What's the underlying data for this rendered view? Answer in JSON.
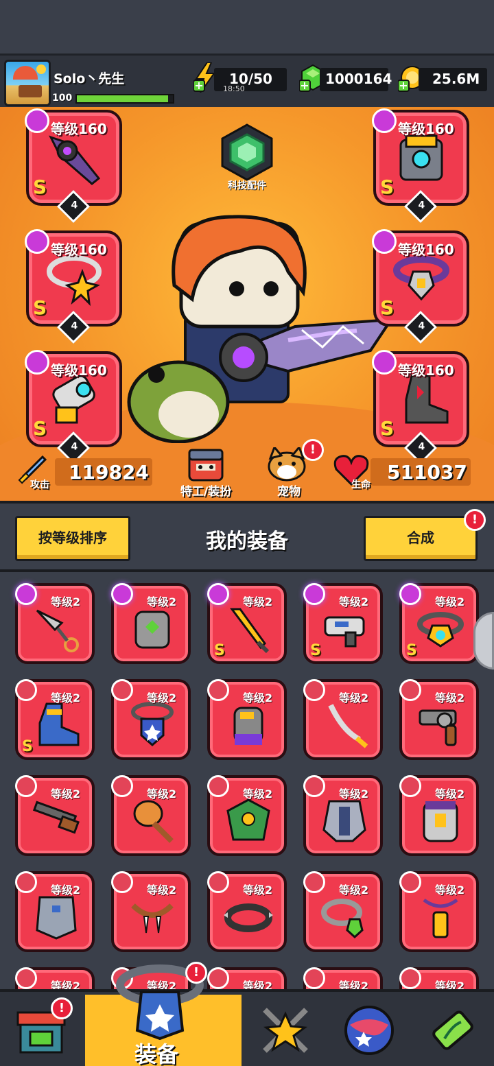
{
  "player": {
    "name": "Solo丶先生",
    "level": "100",
    "xp_fraction": 0.95
  },
  "resources": {
    "energy": "10/50",
    "energy_timer": "18:50",
    "gems": "1000164",
    "coins": "25.6M"
  },
  "hero": {
    "tech_label": "科技配件",
    "attack_label": "攻击",
    "attack_value": "119824",
    "agent_label": "特工/装扮",
    "pet_label": "宠物",
    "hp_label": "生命",
    "hp_value": "511037",
    "slots": [
      {
        "level": "等级160",
        "rank": "S",
        "stars": "4",
        "item": "sword"
      },
      {
        "level": "等级160",
        "rank": "S",
        "stars": "4",
        "item": "chest-armor"
      },
      {
        "level": "等级160",
        "rank": "S",
        "stars": "4",
        "item": "necklace"
      },
      {
        "level": "等级160",
        "rank": "S",
        "stars": "4",
        "item": "belt"
      },
      {
        "level": "等级160",
        "rank": "S",
        "stars": "4",
        "item": "gauntlet"
      },
      {
        "level": "等级160",
        "rank": "S",
        "stars": "4",
        "item": "boots"
      }
    ]
  },
  "inventory": {
    "sort_label": "按等级排序",
    "title": "我的装备",
    "merge_label": "合成",
    "alert_mark": "!",
    "items": [
      {
        "level": "等级2",
        "rank": "",
        "item": "kunai",
        "tag": "glow"
      },
      {
        "level": "等级2",
        "rank": "",
        "item": "armor",
        "tag": "glow"
      },
      {
        "level": "等级2",
        "rank": "S",
        "item": "flame-sword",
        "tag": "glow"
      },
      {
        "level": "等级2",
        "rank": "S",
        "item": "blaster",
        "tag": "glow"
      },
      {
        "level": "等级2",
        "rank": "S",
        "item": "ring-belt",
        "tag": "glow"
      },
      {
        "level": "等级2",
        "rank": "S",
        "item": "boot",
        "tag": ""
      },
      {
        "level": "等级2",
        "rank": "",
        "item": "badge-necklace",
        "tag": ""
      },
      {
        "level": "等级2",
        "rank": "",
        "item": "glove",
        "tag": ""
      },
      {
        "level": "等级2",
        "rank": "",
        "item": "katana",
        "tag": ""
      },
      {
        "level": "等级2",
        "rank": "",
        "item": "revolver",
        "tag": ""
      },
      {
        "level": "等级2",
        "rank": "",
        "item": "shotgun",
        "tag": ""
      },
      {
        "level": "等级2",
        "rank": "",
        "item": "mace",
        "tag": ""
      },
      {
        "level": "等级2",
        "rank": "",
        "item": "leaf-armor",
        "tag": ""
      },
      {
        "level": "等级2",
        "rank": "",
        "item": "plate-armor",
        "tag": ""
      },
      {
        "level": "等级2",
        "rank": "",
        "item": "vest",
        "tag": ""
      },
      {
        "level": "等级2",
        "rank": "",
        "item": "chest-plate",
        "tag": ""
      },
      {
        "level": "等级2",
        "rank": "",
        "item": "fang-necklace",
        "tag": ""
      },
      {
        "level": "等级2",
        "rank": "",
        "item": "spiked-collar",
        "tag": ""
      },
      {
        "level": "等级2",
        "rank": "",
        "item": "gem-ring",
        "tag": ""
      },
      {
        "level": "等级2",
        "rank": "",
        "item": "lantern-pendant",
        "tag": ""
      },
      {
        "level": "等级2",
        "rank": "",
        "item": "partial",
        "tag": ""
      },
      {
        "level": "等级2",
        "rank": "",
        "item": "partial",
        "tag": ""
      },
      {
        "level": "等级2",
        "rank": "",
        "item": "partial",
        "tag": ""
      },
      {
        "level": "等级2",
        "rank": "",
        "item": "partial",
        "tag": ""
      },
      {
        "level": "等级2",
        "rank": "",
        "item": "partial",
        "tag": ""
      }
    ]
  },
  "nav": {
    "equipment_label": "装备"
  },
  "colors": {
    "card": "#f03a4e",
    "accent": "#ffd23a",
    "bg": "#3a3f4a"
  }
}
